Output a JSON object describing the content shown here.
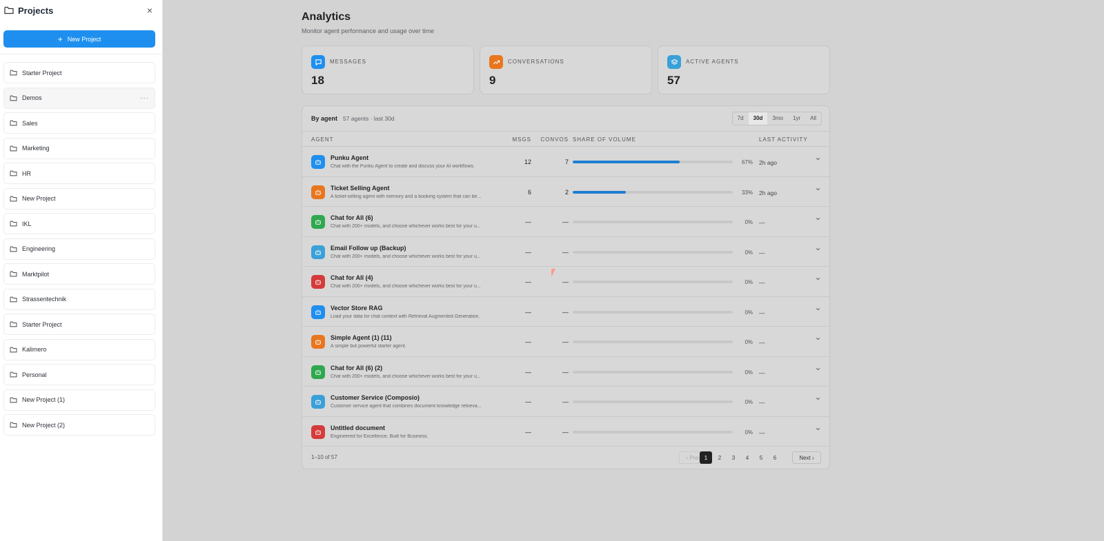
{
  "sidebar": {
    "title": "Projects",
    "close_icon": "×",
    "new_project": {
      "icon": "+",
      "label": "New Project"
    },
    "more_icon": "···",
    "items": [
      {
        "label": "Starter Project"
      },
      {
        "label": "Demos"
      },
      {
        "label": "Sales"
      },
      {
        "label": "Marketing"
      },
      {
        "label": "HR"
      },
      {
        "label": "New Project"
      },
      {
        "label": "IKL"
      },
      {
        "label": "Engineering"
      },
      {
        "label": "Marktpilot"
      },
      {
        "label": "Strassentechnik"
      },
      {
        "label": "Starter Project"
      },
      {
        "label": "Kalimero"
      },
      {
        "label": "Personal"
      },
      {
        "label": "New Project (1)"
      },
      {
        "label": "New Project (2)"
      }
    ]
  },
  "main": {
    "title": "Analytics",
    "subtitle": "Monitor agent performance and usage over time",
    "stats": [
      {
        "label": "MESSAGES",
        "value": "18",
        "color": "#1e8fef",
        "icon": "message-icon"
      },
      {
        "label": "CONVERSATIONS",
        "value": "9",
        "color": "#e8761e",
        "icon": "trend-icon"
      },
      {
        "label": "ACTIVE AGENTS",
        "value": "57",
        "color": "#3aa0d8",
        "icon": "layers-icon"
      }
    ],
    "table": {
      "title": "By agent",
      "summary": "57 agents · last 30d",
      "ranges": [
        "7d",
        "30d",
        "3mo",
        "1yr",
        "All"
      ],
      "active_range": "30d",
      "columns": {
        "agent": "AGENT",
        "msgs": "MSGS",
        "convos": "CONVOS",
        "share": "SHARE OF VOLUME",
        "last": "LAST ACTIVITY"
      },
      "rows": [
        {
          "name": "Punku Agent",
          "desc": "Chat with the Punku Agent to create and discuss your AI workflows.",
          "msgs": "12",
          "convos": "7",
          "share": 67,
          "pct": "67%",
          "last": "2h ago",
          "color": "#1e8fef"
        },
        {
          "name": "Ticket Selling Agent",
          "desc": "A ticket-selling agent with memory and a booking system that can be...",
          "msgs": "6",
          "convos": "2",
          "share": 33,
          "pct": "33%",
          "last": "2h ago",
          "color": "#e8761e"
        },
        {
          "name": "Chat for All (6)",
          "desc": "Chat with 200+ models, and choose whichever works best for your u...",
          "msgs": "—",
          "convos": "—",
          "share": 0,
          "pct": "0%",
          "last": "—",
          "color": "#2fa84f"
        },
        {
          "name": "Email Follow up (Backup)",
          "desc": "Chat with 200+ models, and choose whichever works best for your u...",
          "msgs": "—",
          "convos": "—",
          "share": 0,
          "pct": "0%",
          "last": "—",
          "color": "#3aa0d8"
        },
        {
          "name": "Chat for All (4)",
          "desc": "Chat with 200+ models, and choose whichever works best for your u...",
          "msgs": "—",
          "convos": "—",
          "share": 0,
          "pct": "0%",
          "last": "—",
          "color": "#d63a3a"
        },
        {
          "name": "Vector Store RAG",
          "desc": "Load your data for chat context with Retrieval Augmented Generation.",
          "msgs": "—",
          "convos": "—",
          "share": 0,
          "pct": "0%",
          "last": "—",
          "color": "#1e8fef"
        },
        {
          "name": "Simple Agent (1) (11)",
          "desc": "A simple but powerful starter agent.",
          "msgs": "—",
          "convos": "—",
          "share": 0,
          "pct": "0%",
          "last": "—",
          "color": "#e8761e"
        },
        {
          "name": "Chat for All (6) (2)",
          "desc": "Chat with 200+ models, and choose whichever works best for your u...",
          "msgs": "—",
          "convos": "—",
          "share": 0,
          "pct": "0%",
          "last": "—",
          "color": "#2fa84f"
        },
        {
          "name": "Customer Service (Composio)",
          "desc": "Customer service agent that combines document knowledge retrieva...",
          "msgs": "—",
          "convos": "—",
          "share": 0,
          "pct": "0%",
          "last": "—",
          "color": "#3aa0d8"
        },
        {
          "name": "Untitled document",
          "desc": "Engineered for Excellence, Built for Business.",
          "msgs": "—",
          "convos": "—",
          "share": 0,
          "pct": "0%",
          "last": "—",
          "color": "#d63a3a"
        }
      ],
      "pagination": {
        "count": "1–10 of 57",
        "prev": "‹ Prev",
        "next": "Next ›",
        "pages": [
          "1",
          "2",
          "3",
          "4",
          "5",
          "6"
        ],
        "current": "1"
      }
    }
  }
}
